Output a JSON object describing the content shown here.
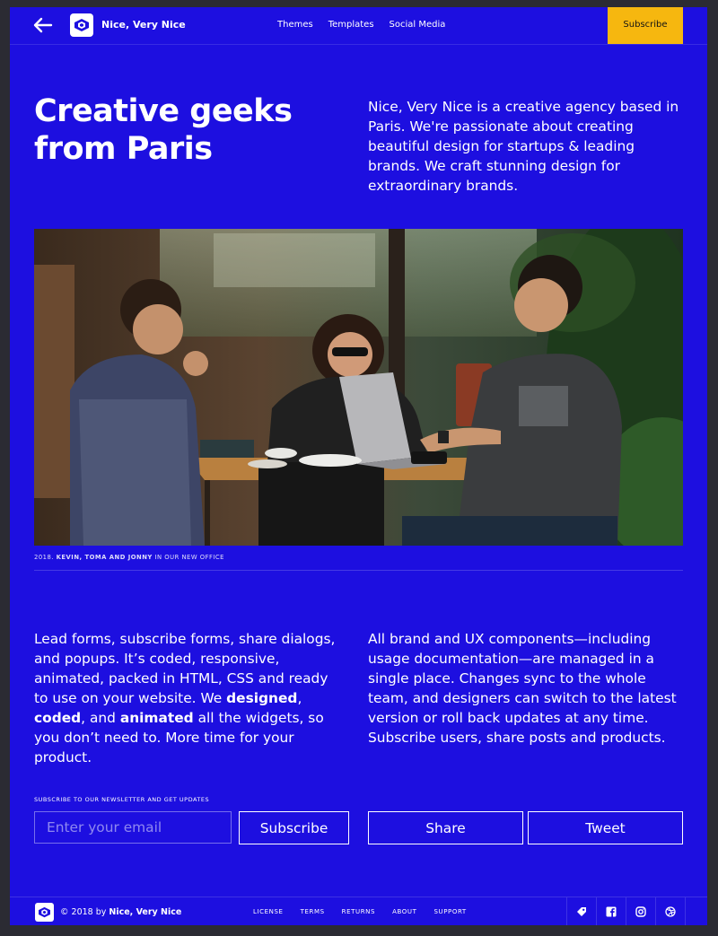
{
  "nav": {
    "brand": "Nice, Very Nice",
    "items": [
      "Themes",
      "Templates",
      "Social Media"
    ],
    "subscribe_label": "Subscribe"
  },
  "hero": {
    "headline_line1": "Creative geeks",
    "headline_line2": "from Paris",
    "intro": "Nice, Very Nice is a creative agency based in Paris. We're passionate about creating beautiful design for startups & leading brands. We craft stunning design for extraordinary brands."
  },
  "photo": {
    "caption_year": "2018.",
    "caption_names": "KEVIN, TOMA AND JONNY",
    "caption_rest": "IN OUR NEW OFFICE"
  },
  "body": {
    "left_start": "Lead forms, subscribe forms, share dialogs, and popups. It’s coded, responsive, animated, packed in HTML, CSS and ready to use on your website. We ",
    "left_bold1": "designed",
    "left_sep1": ", ",
    "left_bold2": "coded",
    "left_sep2": ", and ",
    "left_bold3": "animated",
    "left_end": " all the widgets, so you don’t need to. More time for your product.",
    "right": "All brand and UX components—including usage documentation—are managed in a single place. Changes sync to the whole team, and designers can switch to the latest version or roll back updates at any time. Subscribe users, share posts and products."
  },
  "newsletter": {
    "label": "SUBSCRIBE TO OUR NEWSLETTER AND GET UPDATES",
    "email_placeholder": "Enter your email",
    "subscribe_label": "Subscribe",
    "share_label": "Share",
    "tweet_label": "Tweet"
  },
  "footer": {
    "copy_prefix": "© 2018 by ",
    "copy_brand": "Nice, Very Nice",
    "links": [
      "LICENSE",
      "TERMS",
      "RETURNS",
      "ABOUT",
      "SUPPORT"
    ],
    "social_icons": [
      "product-hunt-icon",
      "facebook-icon",
      "instagram-icon",
      "dribbble-icon"
    ]
  },
  "colors": {
    "background": "#1d0fe0",
    "accent": "#f6b70f",
    "text": "#ffffff"
  }
}
